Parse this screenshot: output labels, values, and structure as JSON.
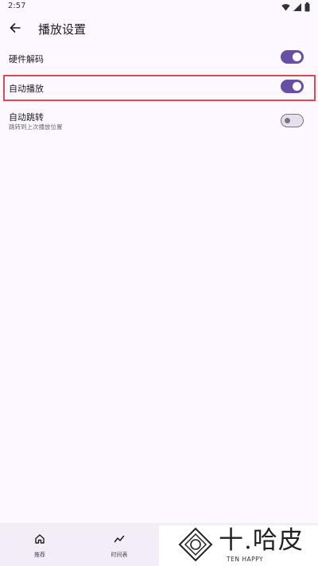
{
  "status_bar": {
    "time": "2:57"
  },
  "header": {
    "title": "播放设置"
  },
  "settings": {
    "hardware_decode": {
      "label": "硬件解码",
      "enabled": true
    },
    "autoplay": {
      "label": "自动播放",
      "enabled": true
    },
    "auto_jump": {
      "label": "自动跳转",
      "sublabel": "跳转到上次播放位置",
      "enabled": false
    }
  },
  "bottom_nav": {
    "items": [
      {
        "label": "推荐",
        "icon": "home-icon"
      },
      {
        "label": "时间表",
        "icon": "trend-icon"
      }
    ]
  },
  "watermark": {
    "text": "十.哈皮",
    "sub": "TEN HAPPY"
  },
  "colors": {
    "accent": "#6750a4",
    "highlight": "#e0484f",
    "background": "#fdf8ff"
  }
}
